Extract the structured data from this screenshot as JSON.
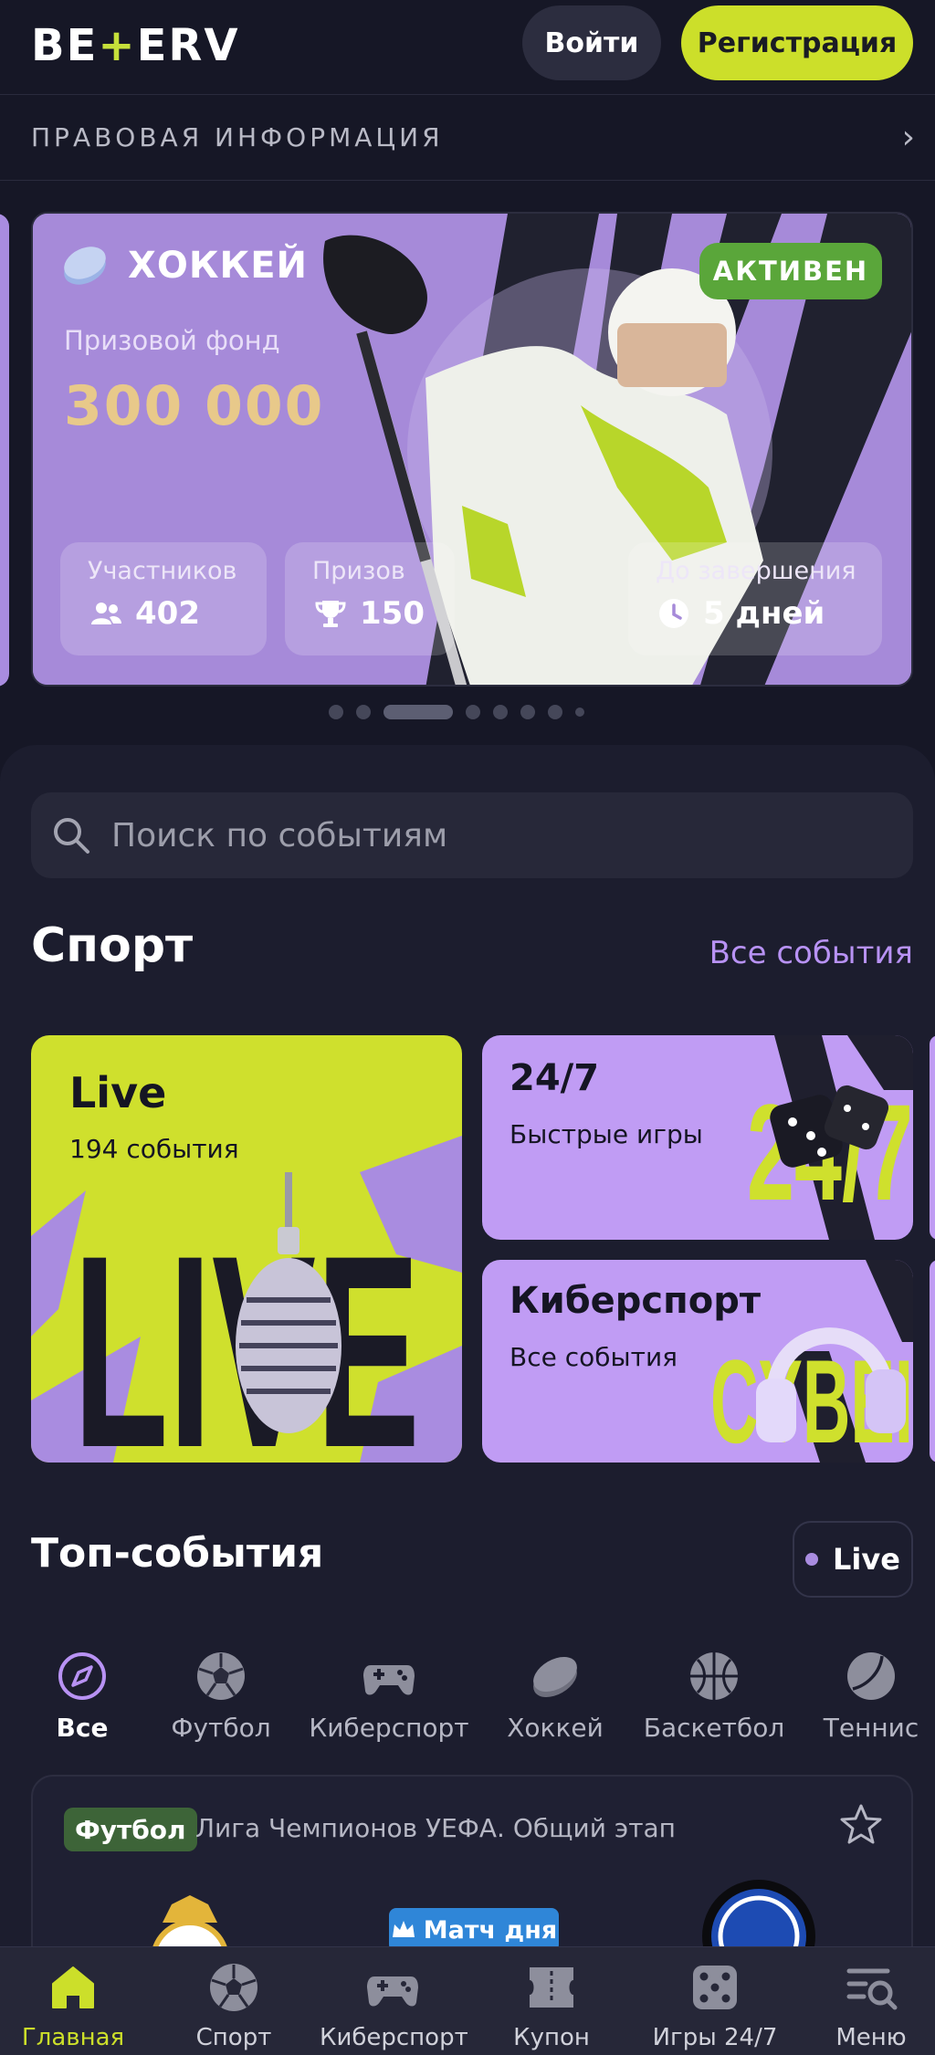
{
  "header": {
    "logo_text_left": "BE",
    "logo_text_plus": "+",
    "logo_text_right": "ERV",
    "login_label": "Войти",
    "register_label": "Регистрация"
  },
  "legal": {
    "label": "ПРАВОВАЯ ИНФОРМАЦИЯ"
  },
  "banner": {
    "sport": "ХОККЕЙ",
    "status": "АКТИВЕН",
    "fund_label": "Призовой фонд",
    "fund_value": "300 000",
    "stats": [
      {
        "label": "Участников",
        "value": "402",
        "icon": "users-icon"
      },
      {
        "label": "Призов",
        "value": "150",
        "icon": "trophy-icon"
      },
      {
        "label": "До завершения",
        "value": "5 дней",
        "icon": "clock-icon"
      }
    ]
  },
  "search": {
    "placeholder": "Поиск по событиям"
  },
  "sport": {
    "title": "Спорт",
    "all_link": "Все события",
    "cards": [
      {
        "title": "Live",
        "subtitle": "194 события"
      },
      {
        "title": "24/7",
        "subtitle": "Быстрые игры"
      },
      {
        "title": "Киберспорт",
        "subtitle": "Все события"
      }
    ]
  },
  "top": {
    "title": "Топ-события",
    "live_chip": "Live",
    "categories": [
      {
        "label": "Все",
        "icon": "compass-icon"
      },
      {
        "label": "Футбол",
        "icon": "soccer-ball-icon"
      },
      {
        "label": "Киберспорт",
        "icon": "gamepad-icon"
      },
      {
        "label": "Хоккей",
        "icon": "hockey-puck-icon"
      },
      {
        "label": "Баскетбол",
        "icon": "basketball-icon"
      },
      {
        "label": "Теннис",
        "icon": "tennis-ball-icon"
      }
    ]
  },
  "match": {
    "sport": "Футбол",
    "league": "Лига Чемпионов УЕФА. Общий этап",
    "badge": "Матч дня"
  },
  "nav": [
    {
      "label": "Главная",
      "icon": "home-icon"
    },
    {
      "label": "Спорт",
      "icon": "soccer-ball-icon"
    },
    {
      "label": "Киберспорт",
      "icon": "gamepad-icon"
    },
    {
      "label": "Купон",
      "icon": "coupon-icon"
    },
    {
      "label": "Игры 24/7",
      "icon": "dice-icon"
    },
    {
      "label": "Меню",
      "icon": "menu-search-icon"
    }
  ],
  "colors": {
    "background": "#161726",
    "accent_lime": "#ccdf2a",
    "accent_purple": "#b892f4",
    "banner_purple": "#a68ad9",
    "active_badge": "#5aa63a",
    "fund_gold": "#e8c98a"
  }
}
